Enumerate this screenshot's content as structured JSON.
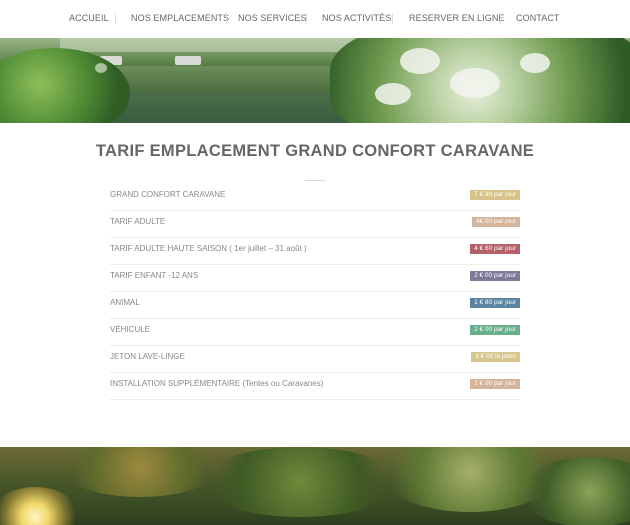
{
  "nav": {
    "items": [
      {
        "label": "ACCUEIL"
      },
      {
        "label": "NOS EMPLACEMENTS"
      },
      {
        "label": "NOS SERVICES"
      },
      {
        "label": "NOS ACTIVITÉS"
      },
      {
        "label": "RESERVER EN LIGNE"
      },
      {
        "label": "CONTACT"
      }
    ]
  },
  "page": {
    "title": "TARIF EMPLACEMENT GRAND CONFORT CARAVANE"
  },
  "prices": [
    {
      "label": "GRAND CONFORT CARAVANE",
      "price": "7 € 30 par jour",
      "color": "#d6c38a"
    },
    {
      "label": "TARIF ADULTE",
      "price": "4€ 00 par jour",
      "color": "#d4b49a"
    },
    {
      "label": "TARIF ADULTE HAUTE SAISON ( 1er juillet – 31 août )",
      "price": "4 € 60 par jour",
      "color": "#b6606a"
    },
    {
      "label": "TARIF ENFANT -12 ANS",
      "price": "2 € 00 par jour",
      "color": "#7c7a96"
    },
    {
      "label": "ANIMAL",
      "price": "1 € 80 par jour",
      "color": "#5b84a2"
    },
    {
      "label": "VÉHICULE",
      "price": "2 € 00 par jour",
      "color": "#69ae8c"
    },
    {
      "label": "JETON LAVE-LINGE",
      "price": "3 € 00 le jeton",
      "color": "#d8c690"
    },
    {
      "label": "INSTALLATION SUPPLÉMENTAIRE (Tentes ou Caravanes)",
      "price": "2 € 00 par jour",
      "color": "#d4b49a"
    }
  ]
}
